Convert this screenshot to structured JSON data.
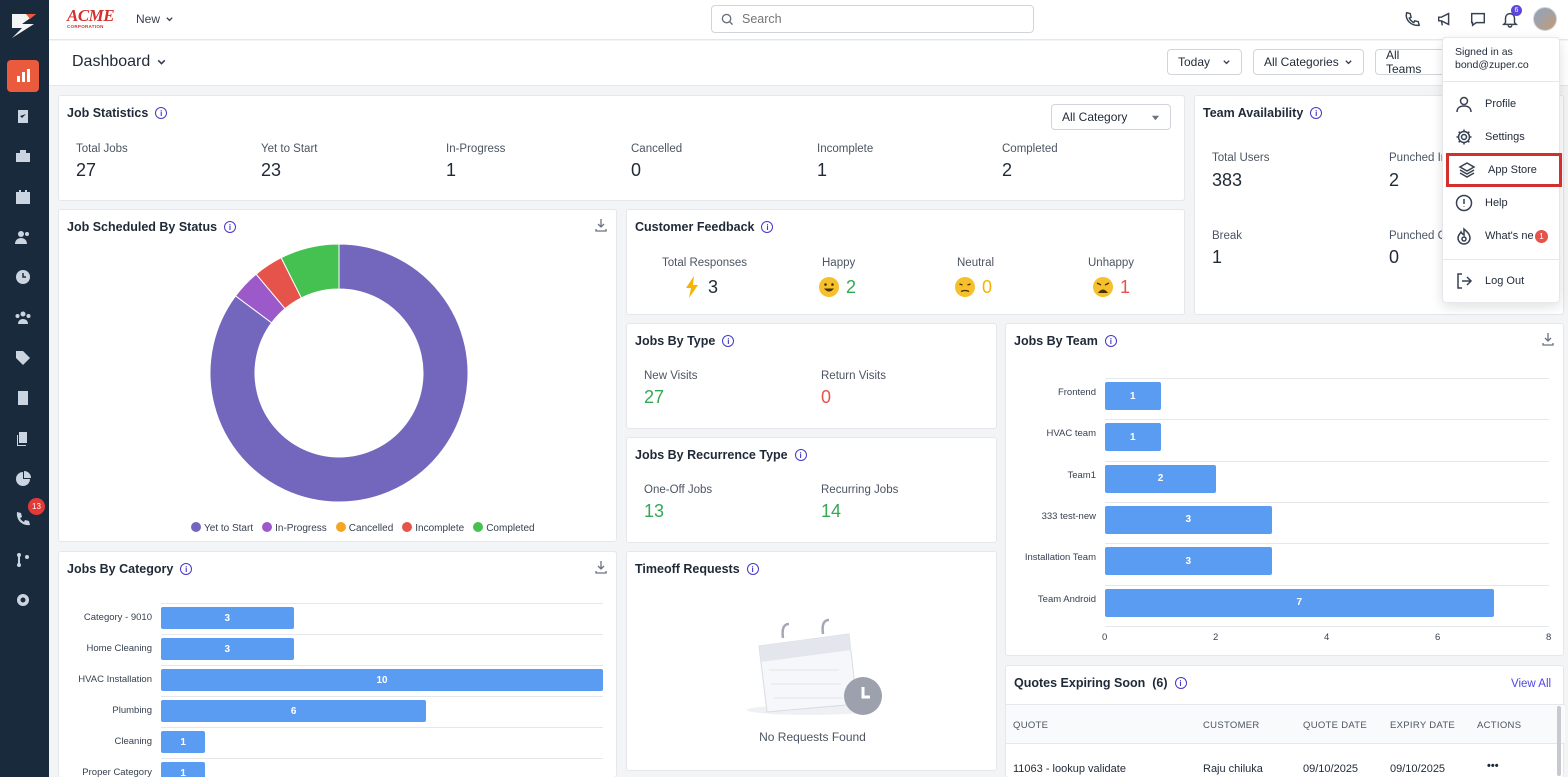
{
  "app": {
    "brand_word": "ACME",
    "brand_sub": "CORPORATION",
    "new_label": "New"
  },
  "search": {
    "placeholder": "Search"
  },
  "notifications": {
    "count": "6"
  },
  "sidebar": {
    "badge": "13"
  },
  "header": {
    "title": "Dashboard"
  },
  "filters": {
    "date": "Today",
    "categories": "All Categories",
    "teams": "All Teams"
  },
  "user_menu": {
    "signed_in_label": "Signed in as",
    "email": "bond@zuper.co",
    "items": [
      {
        "label": "Profile",
        "icon": "user-icon"
      },
      {
        "label": "Settings",
        "icon": "gear-icon"
      },
      {
        "label": "App Store",
        "icon": "layers-icon"
      },
      {
        "label": "Help",
        "icon": "alert-circle-icon"
      },
      {
        "label": "What's ne",
        "icon": "whats-new-icon",
        "badge": "1"
      },
      {
        "label": "Log Out",
        "icon": "logout-icon"
      }
    ]
  },
  "job_statistics": {
    "title": "Job Statistics",
    "category_filter": "All Category",
    "stats": [
      {
        "label": "Total Jobs",
        "value": "27"
      },
      {
        "label": "Yet to Start",
        "value": "23"
      },
      {
        "label": "In-Progress",
        "value": "1"
      },
      {
        "label": "Cancelled",
        "value": "0"
      },
      {
        "label": "Incomplete",
        "value": "1"
      },
      {
        "label": "Completed",
        "value": "2"
      }
    ]
  },
  "team_availability": {
    "title": "Team Availability",
    "stats": [
      {
        "label": "Total Users",
        "value": "383"
      },
      {
        "label": "Punched In",
        "value": "2"
      },
      {
        "label": "Break",
        "value": "1"
      },
      {
        "label": "Punched Out",
        "value": "0"
      }
    ]
  },
  "job_scheduled": {
    "title": "Job Scheduled By Status",
    "chart_data": {
      "type": "pie",
      "donut": true,
      "categories": [
        "Yet to Start",
        "In-Progress",
        "Cancelled",
        "Incomplete",
        "Completed"
      ],
      "values": [
        23,
        1,
        0,
        1,
        2
      ],
      "colors": [
        "#7367bd",
        "#9b59c9",
        "#f5a623",
        "#e5534b",
        "#45c152"
      ],
      "legend": "bottom"
    }
  },
  "customer_feedback": {
    "title": "Customer Feedback",
    "items": [
      {
        "label": "Total Responses",
        "value": "3"
      },
      {
        "label": "Happy",
        "value": "2"
      },
      {
        "label": "Neutral",
        "value": "0"
      },
      {
        "label": "Unhappy",
        "value": "1"
      }
    ]
  },
  "jobs_by_type": {
    "title": "Jobs By Type",
    "items": [
      {
        "label": "New Visits",
        "value": "27"
      },
      {
        "label": "Return Visits",
        "value": "0"
      }
    ]
  },
  "jobs_by_recurrence": {
    "title": "Jobs By Recurrence Type",
    "items": [
      {
        "label": "One-Off Jobs",
        "value": "13"
      },
      {
        "label": "Recurring Jobs",
        "value": "14"
      }
    ]
  },
  "timeoff": {
    "title": "Timeoff Requests",
    "empty_text": "No Requests Found"
  },
  "jobs_by_category": {
    "title": "Jobs By Category",
    "chart_data": {
      "type": "bar",
      "orientation": "horizontal",
      "categories": [
        "Category - 9010",
        "Home Cleaning",
        "HVAC Installation",
        "Plumbing",
        "Cleaning",
        "Proper Category"
      ],
      "values": [
        3,
        3,
        10,
        6,
        1,
        1
      ],
      "xlim": [
        0,
        10
      ]
    }
  },
  "jobs_by_team": {
    "title": "Jobs By Team",
    "chart_data": {
      "type": "bar",
      "orientation": "horizontal",
      "categories": [
        "Frontend",
        "HVAC team",
        "Team1",
        "333 test-new",
        "Installation Team",
        "Team Android"
      ],
      "values": [
        1,
        1,
        2,
        3,
        3,
        7
      ],
      "xlim": [
        0,
        8
      ],
      "xticks": [
        "0",
        "2",
        "4",
        "6",
        "8"
      ]
    }
  },
  "quotes": {
    "title": "Quotes Expiring Soon",
    "count": "(6)",
    "view_all": "View All",
    "columns": [
      "QUOTE",
      "CUSTOMER",
      "QUOTE DATE",
      "EXPIRY DATE",
      "ACTIONS"
    ],
    "rows": [
      {
        "quote": "11063 - lookup validate",
        "customer": "Raju chiluka",
        "quote_date": "09/10/2025",
        "expiry_date": "09/10/2025",
        "actions": "•••"
      }
    ]
  }
}
